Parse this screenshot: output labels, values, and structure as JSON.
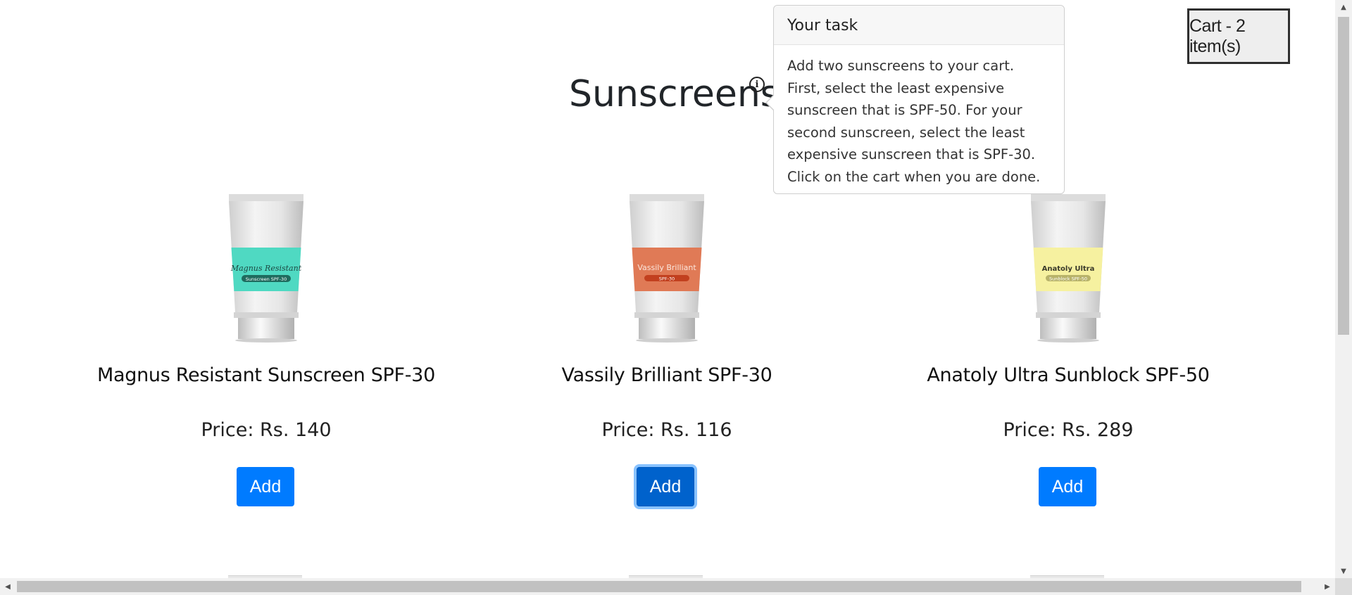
{
  "cart": {
    "label": "Cart - 2 item(s)"
  },
  "page": {
    "title": "Sunscreens",
    "info_icon": "info-circle-icon"
  },
  "task_popover": {
    "title": "Your task",
    "body": "Add two sunscreens to your cart. First, select the least expensive sunscreen that is SPF-50. For your second sunscreen, select the least expensive sunscreen that is SPF-30. Click on the cart when you are done."
  },
  "products": [
    {
      "name": "Magnus Resistant Sunscreen SPF-30",
      "price": "Price: Rs. 140",
      "add_label": "Add",
      "image": {
        "brand": "Magnus Resistant",
        "tag": "Sunscreen SPF-30",
        "color": "#4fd9c2"
      }
    },
    {
      "name": "Vassily Brilliant SPF-30",
      "price": "Price: Rs. 116",
      "add_label": "Add",
      "image": {
        "brand": "Vassily Brilliant",
        "tag": "SPF-30",
        "color": "#e07a56"
      }
    },
    {
      "name": "Anatoly Ultra Sunblock SPF-50",
      "price": "Price: Rs. 289",
      "add_label": "Add",
      "image": {
        "brand": "Anatoly Ultra",
        "tag": "Sunblock SPF-50",
        "color": "#f6f1a0"
      }
    }
  ],
  "colors": {
    "primary": "#007bff",
    "primary_focused": "#0062cc"
  }
}
